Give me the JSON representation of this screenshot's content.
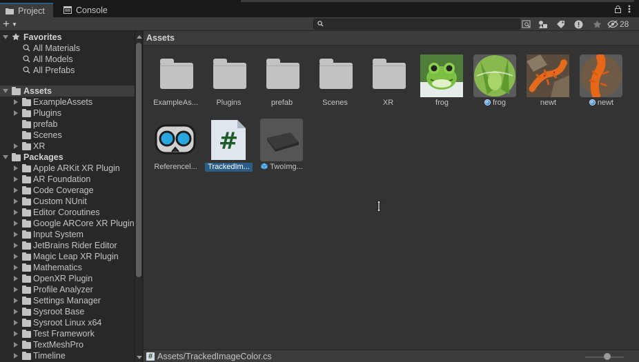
{
  "tabs": [
    {
      "label": "Project",
      "icon": "folder-icon",
      "active": true
    },
    {
      "label": "Console",
      "icon": "console-icon",
      "active": false
    }
  ],
  "toolbar": {
    "add_label": "+",
    "search_placeholder": "",
    "hidden_count": "28"
  },
  "favorites": {
    "header": "Favorites",
    "items": [
      "All Materials",
      "All Models",
      "All Prefabs"
    ]
  },
  "assets_tree": {
    "header": "Assets",
    "items": [
      {
        "label": "ExampleAssets",
        "expandable": true
      },
      {
        "label": "Plugins",
        "expandable": true
      },
      {
        "label": "prefab",
        "expandable": false
      },
      {
        "label": "Scenes",
        "expandable": false
      },
      {
        "label": "XR",
        "expandable": true
      }
    ]
  },
  "packages_tree": {
    "header": "Packages",
    "items": [
      "Apple ARKit XR Plugin",
      "AR Foundation",
      "Code Coverage",
      "Custom NUnit",
      "Editor Coroutines",
      "Google ARCore XR Plugin",
      "Input System",
      "JetBrains Rider Editor",
      "Magic Leap XR Plugin",
      "Mathematics",
      "OpenXR Plugin",
      "Profile Analyzer",
      "Settings Manager",
      "Sysroot Base",
      "Sysroot Linux x64",
      "Test Framework",
      "TextMeshPro",
      "Timeline"
    ]
  },
  "content": {
    "breadcrumb": "Assets",
    "items": [
      {
        "name": "ExampleAs...",
        "kind": "folder"
      },
      {
        "name": "Plugins",
        "kind": "folder"
      },
      {
        "name": "prefab",
        "kind": "folder"
      },
      {
        "name": "Scenes",
        "kind": "folder"
      },
      {
        "name": "XR",
        "kind": "folder"
      },
      {
        "name": "frog",
        "kind": "texture-frog"
      },
      {
        "name": "frog",
        "kind": "sprite-frog"
      },
      {
        "name": "newt",
        "kind": "texture-newt"
      },
      {
        "name": "newt",
        "kind": "sprite-newt"
      },
      {
        "name": "Referencel...",
        "kind": "xr-reference-library"
      },
      {
        "name": "TrackedIm...",
        "kind": "csharp-script",
        "selected": true
      },
      {
        "name": "TwoImg...",
        "kind": "prefab"
      }
    ]
  },
  "status": {
    "path": "Assets/TrackedImageColor.cs"
  },
  "colors": {
    "selection": "#2c5d87",
    "panel": "#333333",
    "tree_bg": "#282828"
  }
}
